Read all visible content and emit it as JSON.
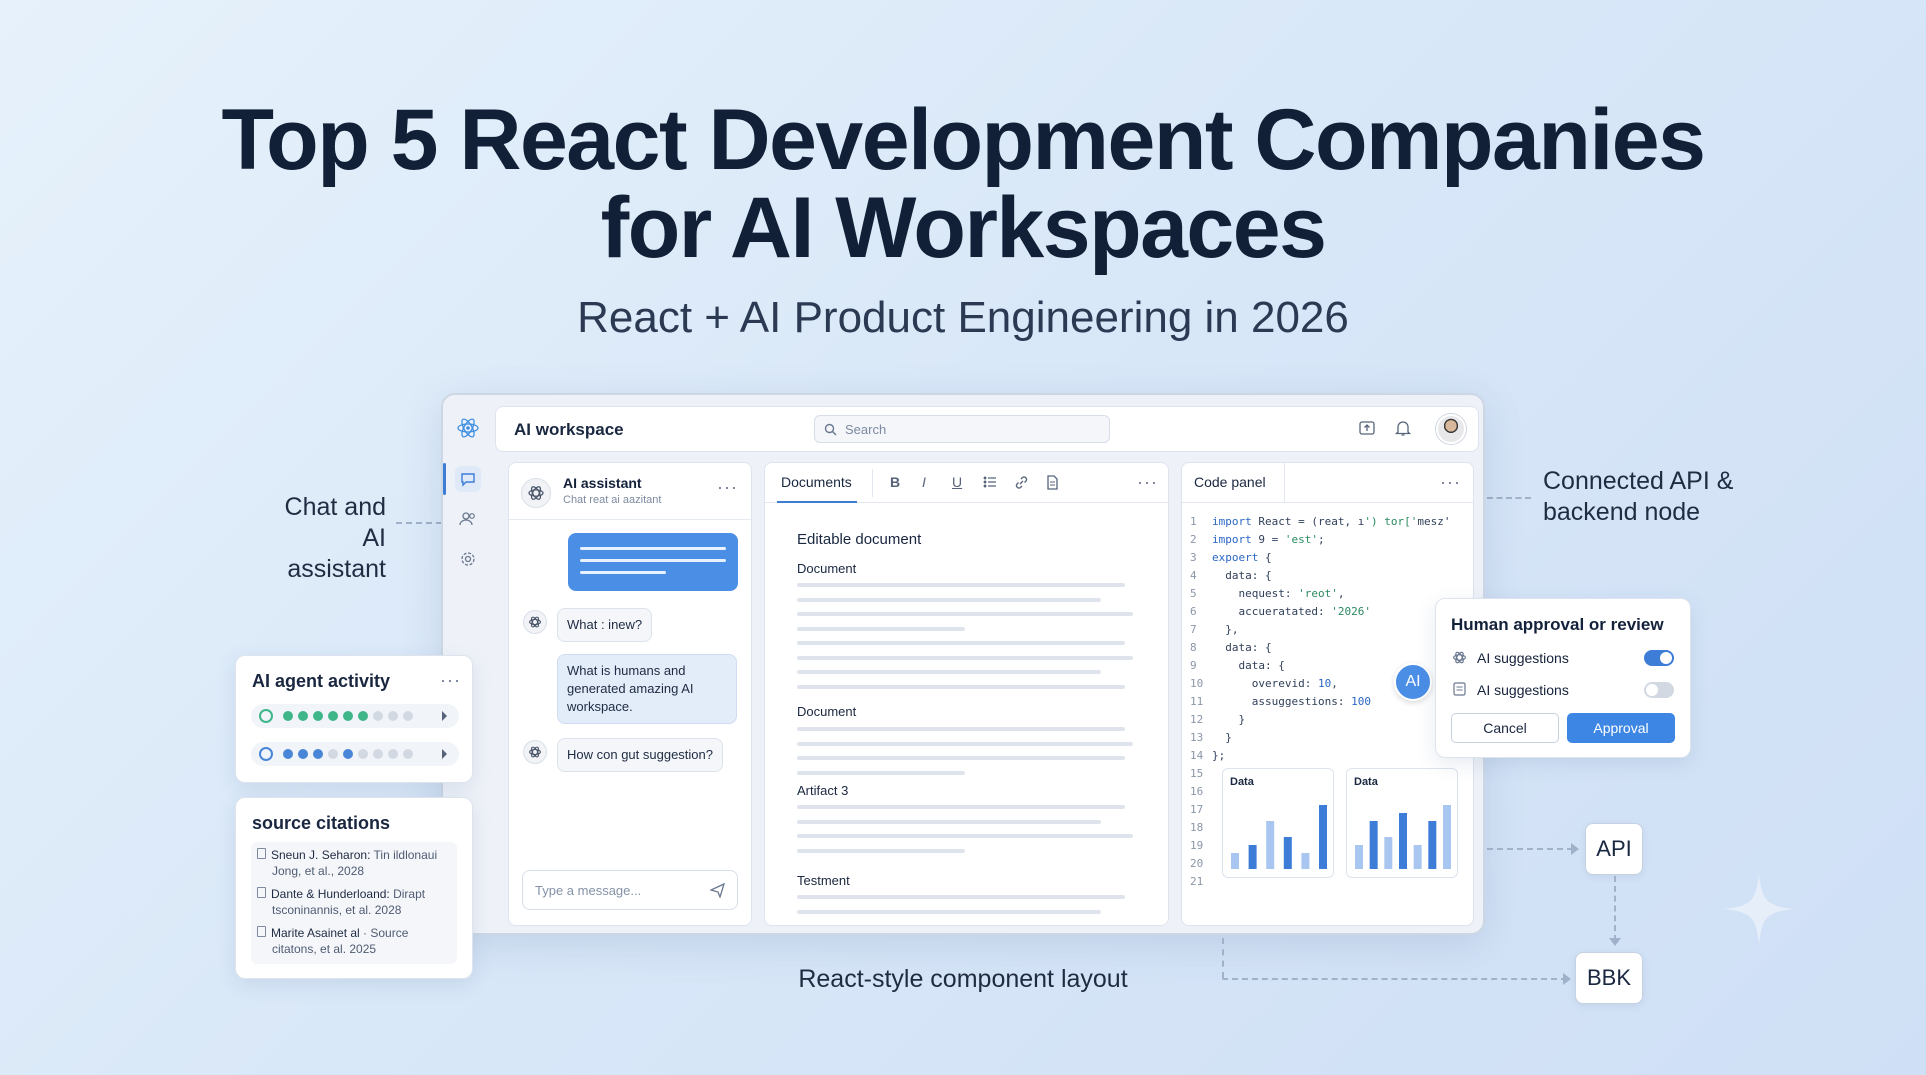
{
  "hero": {
    "title_line1": "Top 5 React Development Companies",
    "title_line2": "for AI Workspaces",
    "subtitle": "React + AI Product Engineering in 2026"
  },
  "callouts": {
    "chat_line1": "Chat and",
    "chat_line2": "AI assistant",
    "api_line1": "Connected API &",
    "api_line2": "backend node",
    "layout": "React-style component layout"
  },
  "workspace": {
    "title": "AI workspace",
    "search_placeholder": "Search"
  },
  "chat": {
    "assistant_name": "AI assistant",
    "assistant_subtitle": "Chat reat ai aazitant",
    "messages": [
      "What : inew?",
      "What is humans and generated amazing AI workspace.",
      "How con gut suggestion?"
    ],
    "input_placeholder": "Type a message..."
  },
  "documents": {
    "tab": "Documents",
    "toolbar": [
      "B",
      "I",
      "U"
    ],
    "heading": "Editable document",
    "sections": [
      "Document",
      "Document",
      "Artifact 3",
      "Testment"
    ]
  },
  "code_panel": {
    "tab": "Code panel",
    "badge": "AI",
    "lines": [
      "import React = (reat, ı') tor['mesz'",
      "import 9 = 'est';",
      "expoert {",
      "  data: {",
      "    nequest: 'reot',",
      "    accueratated: '2026'",
      "  },",
      "  data: {",
      "    data: {",
      "      overevid: 10,",
      "      assuggestions: 100",
      "    }",
      "  }",
      "};",
      "",
      "",
      "",
      "",
      "",
      "",
      ""
    ],
    "charts": [
      {
        "title": "Data",
        "values": [
          2,
          3,
          6,
          4,
          2,
          8
        ]
      },
      {
        "title": "Data",
        "values": [
          3,
          6,
          4,
          7,
          3,
          6,
          8
        ]
      }
    ]
  },
  "agent_activity": {
    "title": "AI agent activity",
    "rows": [
      {
        "color": "#3fb58a",
        "active": 6,
        "total": 9
      },
      {
        "color": "#4a86d8",
        "active": 3,
        "total": 9
      }
    ]
  },
  "citations": {
    "title": "source citations",
    "items": [
      {
        "bold": "Sneun J. Seharon:",
        "text": " Tin ildlonaui",
        "sub": "Jong, et al., 2028"
      },
      {
        "bold": "Dante & Hunderloand:",
        "text": " Dirapt",
        "sub": "tsconinannis, et al. 2028"
      },
      {
        "bold": "Marite Asainet al",
        "text": " · Source",
        "sub": "citatons, et al. 2025"
      }
    ]
  },
  "approval": {
    "title": "Human approval or review",
    "option1": "AI suggestions",
    "option1_on": true,
    "option2": "AI suggestions",
    "option2_on": false,
    "cancel": "Cancel",
    "approve": "Approval"
  },
  "nodes": {
    "api": "API",
    "backend": "BBK"
  },
  "colors": {
    "accent": "#4a8ee6",
    "green": "#3fb58a",
    "text": "#112036"
  }
}
